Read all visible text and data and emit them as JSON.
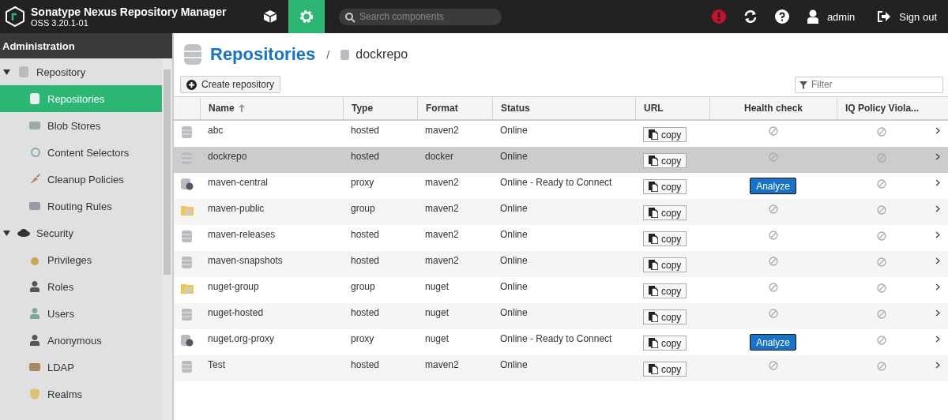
{
  "header": {
    "title": "Sonatype Nexus Repository Manager",
    "version": "OSS 3.20.1-01",
    "search_placeholder": "Search components",
    "user": "admin",
    "sign_out": "Sign out"
  },
  "sidebar": {
    "title": "Administration",
    "items": [
      {
        "label": "Repository",
        "expanded": true,
        "children": [
          {
            "label": "Repositories",
            "selected": true
          },
          {
            "label": "Blob Stores",
            "selected": false
          },
          {
            "label": "Content Selectors",
            "selected": false
          },
          {
            "label": "Cleanup Policies",
            "selected": false
          },
          {
            "label": "Routing Rules",
            "selected": false
          }
        ]
      },
      {
        "label": "Security",
        "expanded": true,
        "children": [
          {
            "label": "Privileges",
            "selected": false
          },
          {
            "label": "Roles",
            "selected": false
          },
          {
            "label": "Users",
            "selected": false
          },
          {
            "label": "Anonymous",
            "selected": false
          },
          {
            "label": "LDAP",
            "selected": false
          },
          {
            "label": "Realms",
            "selected": false
          }
        ]
      }
    ]
  },
  "breadcrumb": {
    "title": "Repositories",
    "separator": "/",
    "current": "dockrepo"
  },
  "toolbar": {
    "create": "Create repository",
    "filter_placeholder": "Filter"
  },
  "table": {
    "columns": [
      "Name",
      "Type",
      "Format",
      "Status",
      "URL",
      "Health check",
      "IQ Policy Viola..."
    ],
    "rows": [
      {
        "kind": "hosted",
        "name": "abc",
        "type": "hosted",
        "format": "maven2",
        "status": "Online",
        "url": "copy",
        "selected": false
      },
      {
        "kind": "hosted",
        "name": "dockrepo",
        "type": "hosted",
        "format": "docker",
        "status": "Online",
        "url": "copy",
        "selected": true
      },
      {
        "kind": "proxy",
        "name": "maven-central",
        "type": "proxy",
        "format": "maven2",
        "status": "Online - Ready to Connect",
        "url": "copy",
        "health_button": "Analyze",
        "selected": false
      },
      {
        "kind": "group",
        "name": "maven-public",
        "type": "group",
        "format": "maven2",
        "status": "Online",
        "url": "copy",
        "selected": false
      },
      {
        "kind": "hosted",
        "name": "maven-releases",
        "type": "hosted",
        "format": "maven2",
        "status": "Online",
        "url": "copy",
        "selected": false
      },
      {
        "kind": "hosted",
        "name": "maven-snapshots",
        "type": "hosted",
        "format": "maven2",
        "status": "Online",
        "url": "copy",
        "selected": false
      },
      {
        "kind": "group",
        "name": "nuget-group",
        "type": "group",
        "format": "nuget",
        "status": "Online",
        "url": "copy",
        "selected": false
      },
      {
        "kind": "hosted",
        "name": "nuget-hosted",
        "type": "hosted",
        "format": "nuget",
        "status": "Online",
        "url": "copy",
        "selected": false
      },
      {
        "kind": "proxy",
        "name": "nuget.org-proxy",
        "type": "proxy",
        "format": "nuget",
        "status": "Online - Ready to Connect",
        "url": "copy",
        "health_button": "Analyze",
        "selected": false
      },
      {
        "kind": "hosted",
        "name": "Test",
        "type": "hosted",
        "format": "maven2",
        "status": "Online",
        "url": "copy",
        "selected": false
      }
    ]
  }
}
